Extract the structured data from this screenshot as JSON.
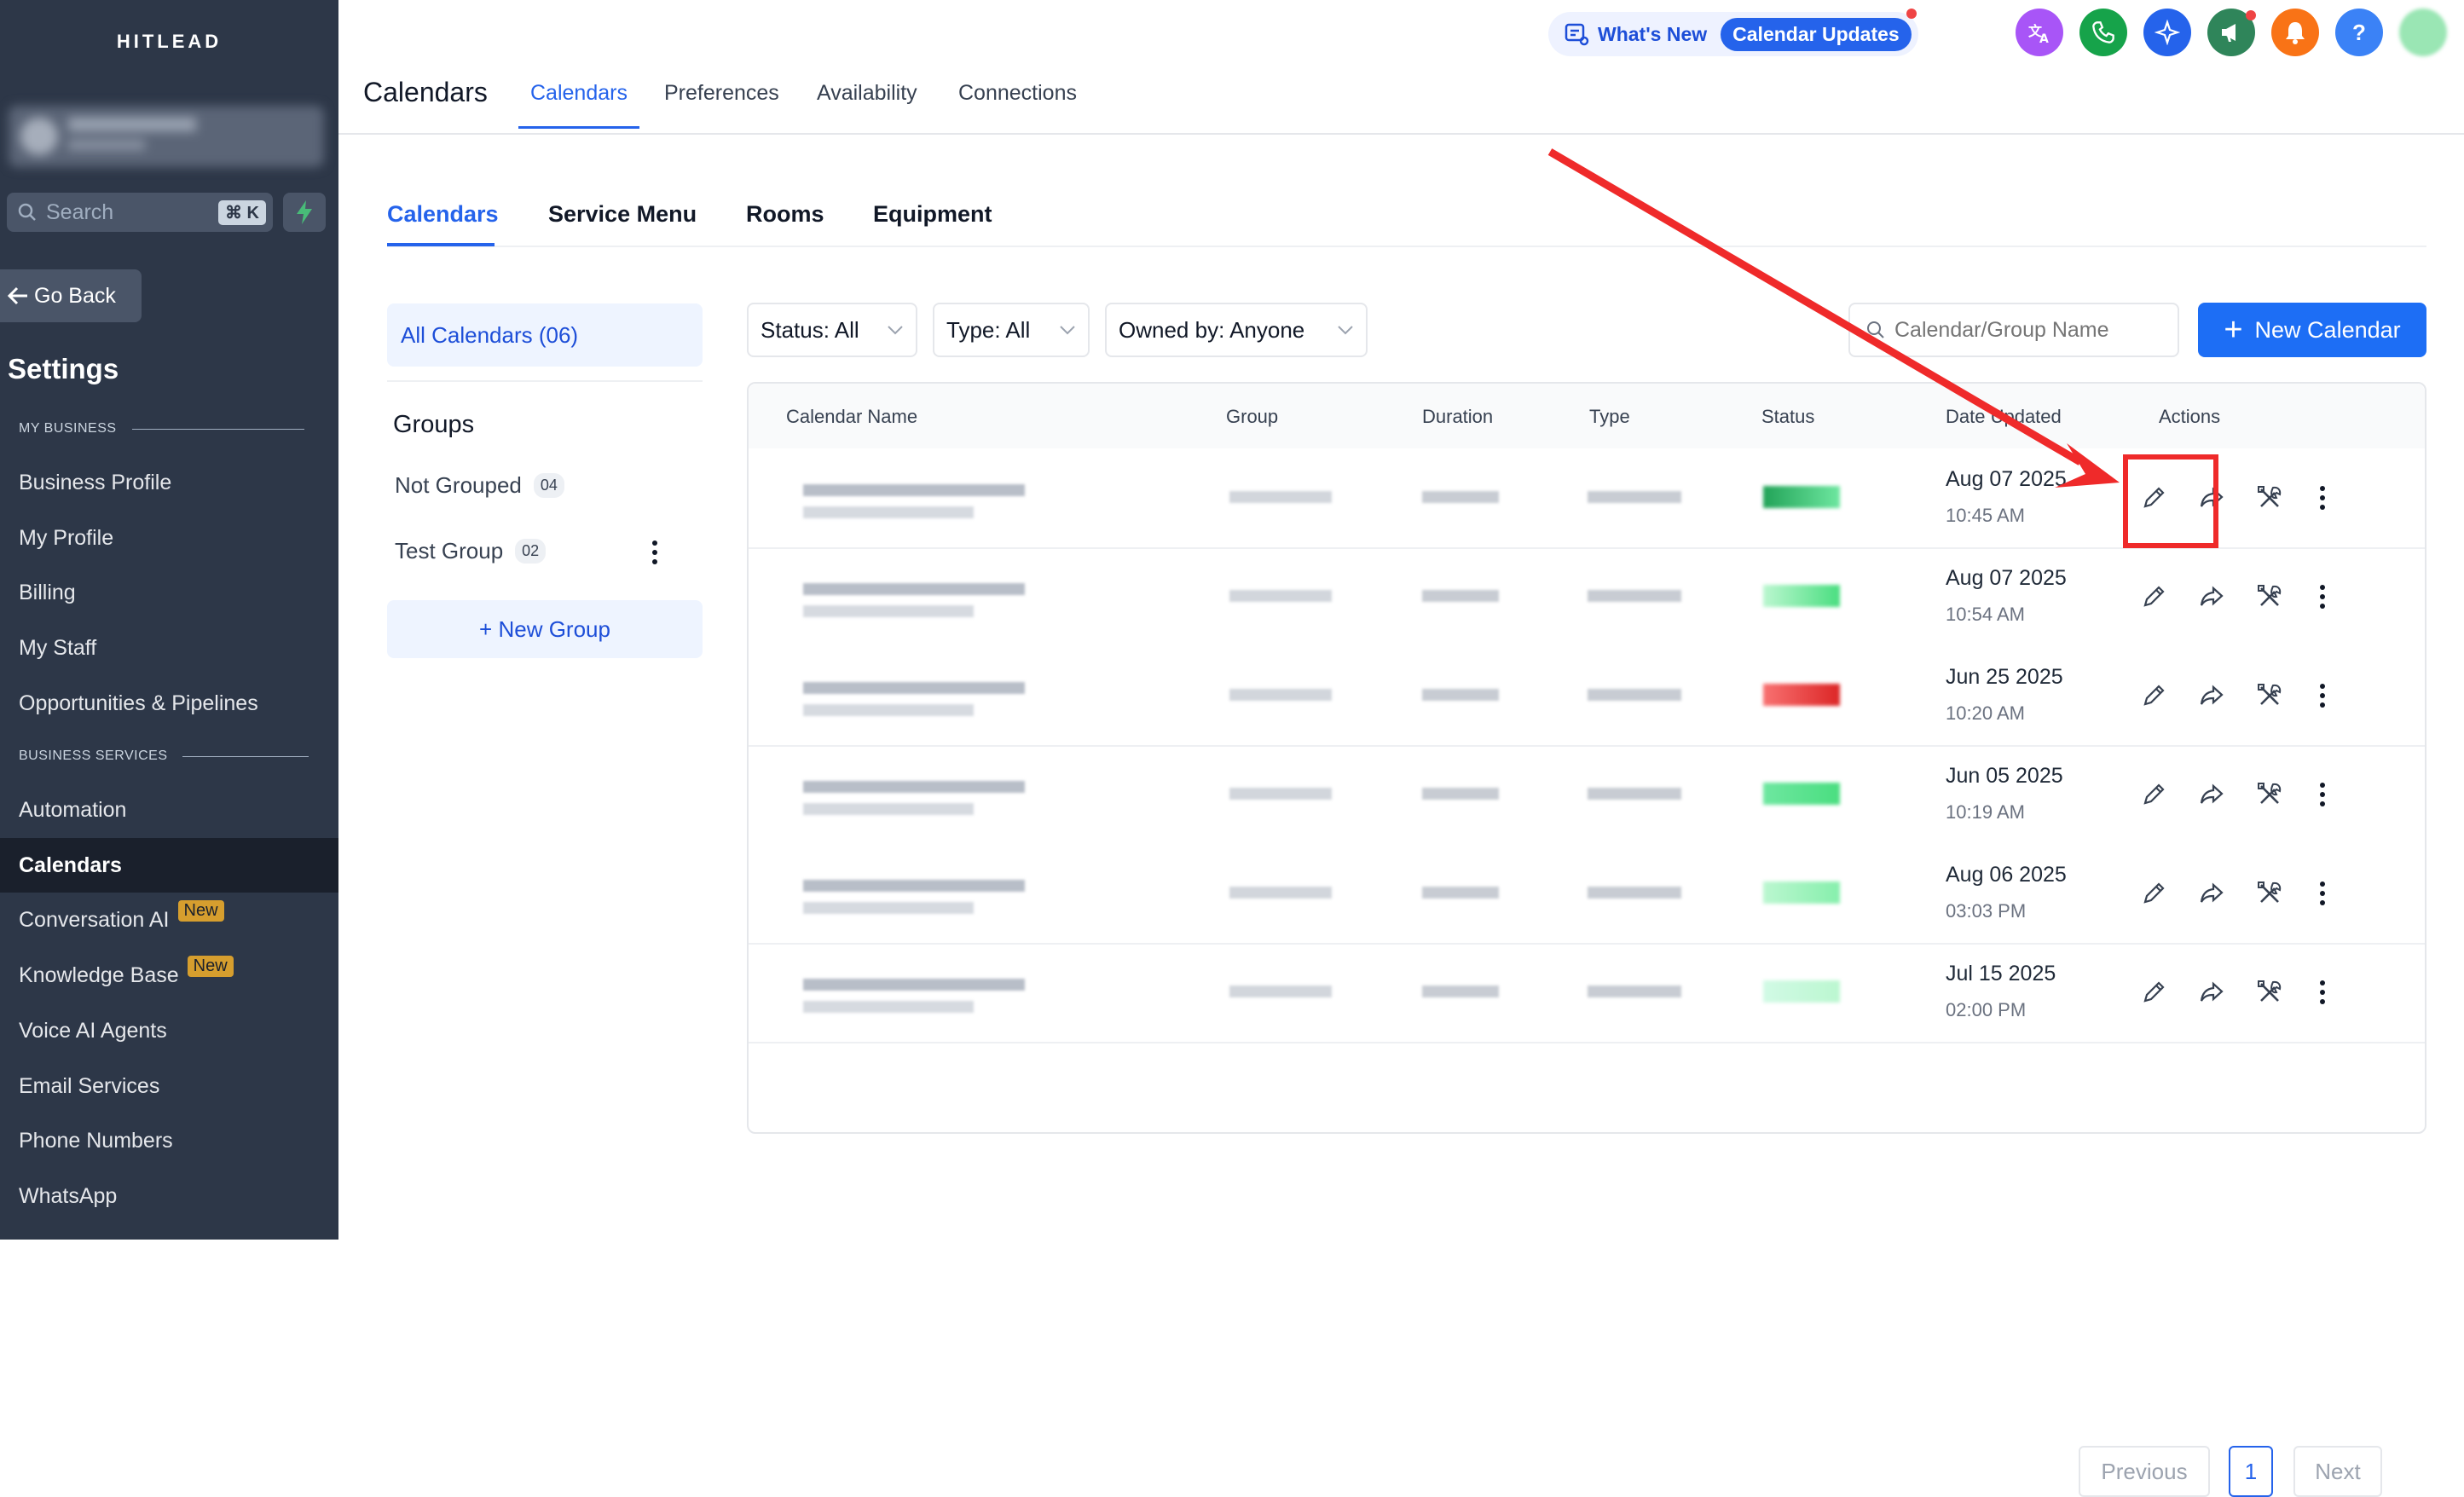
{
  "sidebar": {
    "brand": "HITLEAD",
    "search_label": "Search",
    "search_shortcut": "⌘ K",
    "go_back": "Go Back",
    "settings_title": "Settings",
    "sections": {
      "my_business": "MY BUSINESS",
      "business_services": "BUSINESS SERVICES"
    },
    "items": [
      {
        "label": "Business Profile"
      },
      {
        "label": "My Profile"
      },
      {
        "label": "Billing"
      },
      {
        "label": "My Staff"
      },
      {
        "label": "Opportunities & Pipelines"
      },
      {
        "label": "Automation"
      },
      {
        "label": "Calendars",
        "active": true
      },
      {
        "label": "Conversation AI",
        "badge": "New"
      },
      {
        "label": "Knowledge Base",
        "badge": "New"
      },
      {
        "label": "Voice AI Agents"
      },
      {
        "label": "Email Services"
      },
      {
        "label": "Phone Numbers"
      },
      {
        "label": "WhatsApp"
      }
    ]
  },
  "header": {
    "page_title": "Calendars",
    "tabs": [
      "Calendars",
      "Preferences",
      "Availability",
      "Connections"
    ],
    "whats_new": "What's New",
    "calendar_updates": "Calendar Updates",
    "icons": [
      {
        "name": "translate-icon",
        "color": "#a855f7"
      },
      {
        "name": "phone-icon",
        "color": "#16a34a"
      },
      {
        "name": "sparkle-icon",
        "color": "#2563eb"
      },
      {
        "name": "megaphone-icon",
        "color": "#2f855a"
      },
      {
        "name": "bell-icon",
        "color": "#f97316"
      },
      {
        "name": "help-icon",
        "color": "#3b82f6",
        "text": "?"
      }
    ]
  },
  "subtabs": [
    "Calendars",
    "Service Menu",
    "Rooms",
    "Equipment"
  ],
  "groups_panel": {
    "all_calendars": "All Calendars (06)",
    "groups_title": "Groups",
    "groups": [
      {
        "name": "Not Grouped",
        "count": "04"
      },
      {
        "name": "Test Group",
        "count": "02"
      }
    ],
    "new_group": "+ New Group"
  },
  "filters": {
    "status": "Status: All",
    "type": "Type: All",
    "owned_by": "Owned by: Anyone",
    "search_placeholder": "Calendar/Group Name",
    "new_calendar": "New Calendar"
  },
  "table": {
    "columns": [
      "Calendar Name",
      "Group",
      "Duration",
      "Type",
      "Status",
      "Date Updated",
      "Actions"
    ],
    "rows": [
      {
        "date": "Aug 07 2025",
        "time": "10:45 AM"
      },
      {
        "date": "Aug 07 2025",
        "time": "10:54 AM"
      },
      {
        "date": "Jun 25 2025",
        "time": "10:20 AM"
      },
      {
        "date": "Jun 05 2025",
        "time": "10:19 AM"
      },
      {
        "date": "Aug 06 2025",
        "time": "03:03 PM"
      },
      {
        "date": "Jul 15 2025",
        "time": "02:00 PM"
      }
    ]
  },
  "pagination": {
    "previous": "Previous",
    "current": "1",
    "next": "Next"
  },
  "colors": {
    "sidebar_bg": "#2d3748",
    "accent": "#2563eb",
    "annotation_red": "#ef2a2a"
  }
}
